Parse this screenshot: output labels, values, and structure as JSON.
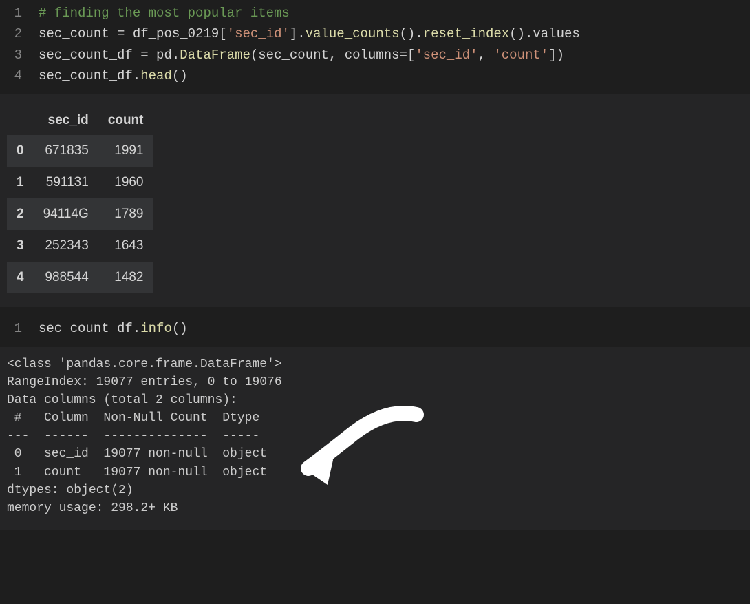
{
  "cell1": {
    "lines": [
      {
        "n": "1",
        "tokens": [
          {
            "t": "# finding the most popular items",
            "c": "comment"
          }
        ]
      },
      {
        "n": "2",
        "tokens": [
          {
            "t": "sec_count ",
            "c": "plain"
          },
          {
            "t": "=",
            "c": "plain"
          },
          {
            "t": " df_pos_0219[",
            "c": "plain"
          },
          {
            "t": "'sec_id'",
            "c": "string"
          },
          {
            "t": "].",
            "c": "plain"
          },
          {
            "t": "value_counts",
            "c": "func"
          },
          {
            "t": "().",
            "c": "plain"
          },
          {
            "t": "reset_index",
            "c": "func"
          },
          {
            "t": "().values",
            "c": "plain"
          }
        ]
      },
      {
        "n": "3",
        "tokens": [
          {
            "t": "sec_count_df ",
            "c": "plain"
          },
          {
            "t": "=",
            "c": "plain"
          },
          {
            "t": " pd.",
            "c": "plain"
          },
          {
            "t": "DataFrame",
            "c": "func"
          },
          {
            "t": "(sec_count, columns",
            "c": "plain"
          },
          {
            "t": "=",
            "c": "plain"
          },
          {
            "t": "[",
            "c": "plain"
          },
          {
            "t": "'sec_id'",
            "c": "string"
          },
          {
            "t": ", ",
            "c": "plain"
          },
          {
            "t": "'count'",
            "c": "string"
          },
          {
            "t": "])",
            "c": "plain"
          }
        ]
      },
      {
        "n": "4",
        "tokens": [
          {
            "t": "sec_count_df.",
            "c": "plain"
          },
          {
            "t": "head",
            "c": "func"
          },
          {
            "t": "()",
            "c": "plain"
          }
        ]
      }
    ]
  },
  "dataframe": {
    "columns": [
      "sec_id",
      "count"
    ],
    "rows": [
      {
        "idx": "0",
        "sec_id": "671835",
        "count": "1991"
      },
      {
        "idx": "1",
        "sec_id": "591131",
        "count": "1960"
      },
      {
        "idx": "2",
        "sec_id": "94114G",
        "count": "1789"
      },
      {
        "idx": "3",
        "sec_id": "252343",
        "count": "1643"
      },
      {
        "idx": "4",
        "sec_id": "988544",
        "count": "1482"
      }
    ]
  },
  "cell2": {
    "lines": [
      {
        "n": "1",
        "tokens": [
          {
            "t": "sec_count_df.",
            "c": "plain"
          },
          {
            "t": "info",
            "c": "func"
          },
          {
            "t": "()",
            "c": "plain"
          }
        ]
      }
    ]
  },
  "info_output": "<class 'pandas.core.frame.DataFrame'>\nRangeIndex: 19077 entries, 0 to 19076\nData columns (total 2 columns):\n #   Column  Non-Null Count  Dtype \n---  ------  --------------  ----- \n 0   sec_id  19077 non-null  object\n 1   count   19077 non-null  object\ndtypes: object(2)\nmemory usage: 298.2+ KB"
}
